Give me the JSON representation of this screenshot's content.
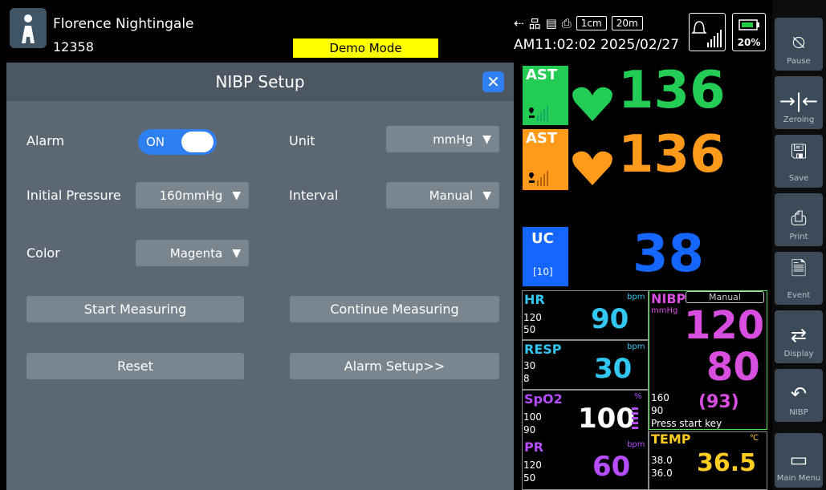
{
  "patient": {
    "name": "Florence Nightingale",
    "id": "12358"
  },
  "demo_mode": "Demo Mode",
  "status": {
    "scale_1": "1cm",
    "scale_2": "20m",
    "clock": "AM11:02:02 2025/02/27",
    "battery_pct": "20%"
  },
  "sidebar": [
    {
      "label": "Pause",
      "icon": "alarm-pause-icon"
    },
    {
      "label": "Zeroing",
      "icon": "zeroing-icon"
    },
    {
      "label": "Save",
      "icon": "save-icon"
    },
    {
      "label": "Print",
      "icon": "print-icon"
    },
    {
      "label": "Event",
      "icon": "event-icon"
    },
    {
      "label": "Display",
      "icon": "display-icon"
    },
    {
      "label": "NIBP",
      "icon": "nibp-cuff-icon"
    },
    {
      "label": "Main Menu",
      "icon": "main-menu-icon"
    }
  ],
  "dialog": {
    "title": "NIBP Setup",
    "alarm_label": "Alarm",
    "alarm_value": "ON",
    "unit_label": "Unit",
    "unit_value": "mmHg",
    "initial_pressure_label": "Initial Pressure",
    "initial_pressure_value": "160mmHg",
    "interval_label": "Interval",
    "interval_value": "Manual",
    "color_label": "Color",
    "color_value": "Magenta",
    "start_button": "Start Measuring",
    "continue_button": "Continue Measuring",
    "reset_button": "Reset",
    "alarm_setup_button": "Alarm Setup>>"
  },
  "ast1": {
    "label": "AST",
    "value": "136",
    "color": "#22cc55"
  },
  "ast2": {
    "label": "AST",
    "value": "136",
    "color": "#ff9a1a"
  },
  "uc": {
    "label": "UC",
    "sub": "[10]",
    "value": "38",
    "color": "#1466ff"
  },
  "hr": {
    "label": "HR",
    "unit": "bpm",
    "high": "120",
    "low": "50",
    "value": "90",
    "color": "#33c6f0"
  },
  "resp": {
    "label": "RESP",
    "unit": "bpm",
    "high": "30",
    "low": "8",
    "value": "30",
    "color": "#33c6f0"
  },
  "spo2": {
    "label": "SpO2",
    "unit": "%",
    "high": "100",
    "low": "90",
    "value": "100",
    "color": "#b54dff"
  },
  "pr": {
    "label": "PR",
    "unit": "bpm",
    "high": "120",
    "low": "50",
    "value": "60",
    "color": "#b54dff"
  },
  "nibp": {
    "label": "NIBP",
    "mode": "Manual",
    "unit": "mmHg",
    "sys": "120",
    "dia": "80",
    "map": "(93)",
    "high": "160",
    "low": "90",
    "msg": "Press start key",
    "color": "#d84fe0"
  },
  "temp": {
    "label": "TEMP",
    "unit": "℃",
    "high": "38.0",
    "low": "36.0",
    "value": "36.5",
    "color": "#ffcc22"
  }
}
